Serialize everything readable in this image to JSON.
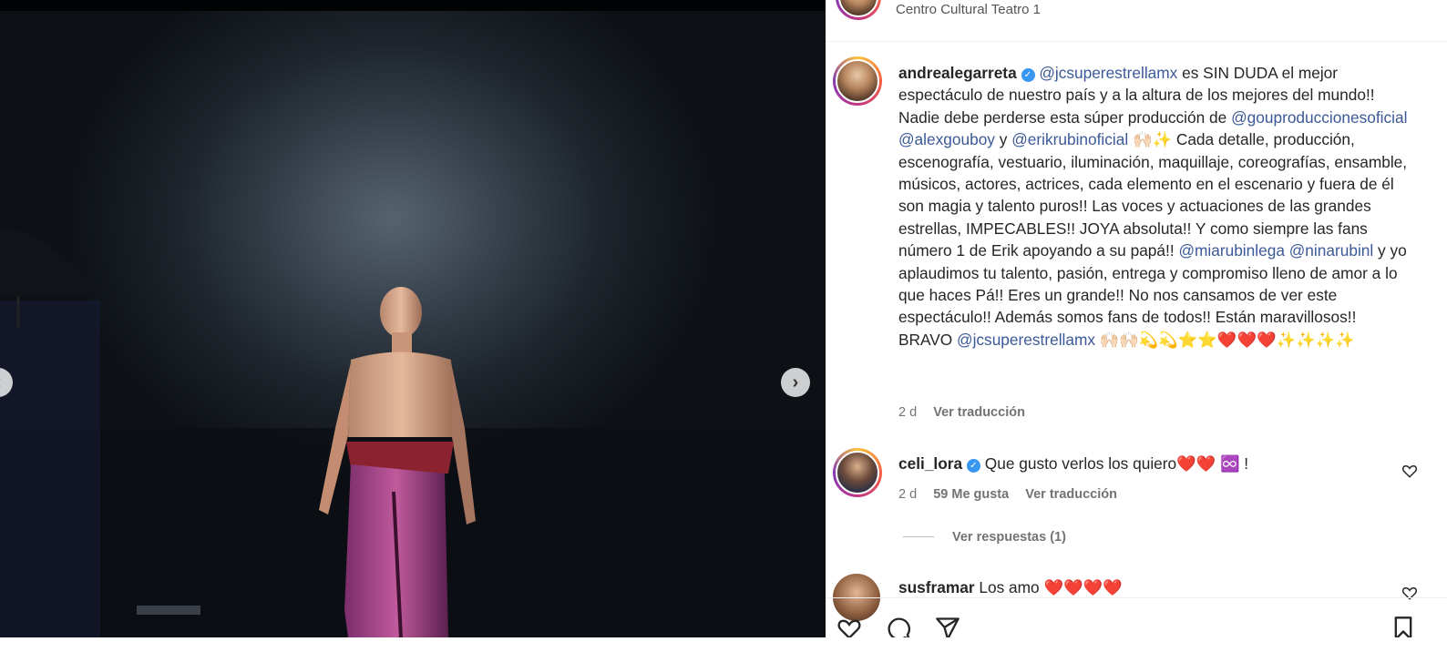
{
  "post": {
    "location": "Centro Cultural Teatro 1",
    "media_alt": "Performer on stage",
    "caption": {
      "username": "andrealegarreta",
      "verified": true,
      "segments": [
        {
          "type": "mention",
          "text": "@jcsuperestrellamx"
        },
        {
          "type": "text",
          "text": " es SIN DUDA el mejor espectáculo de nuestro país y a la altura de los mejores del mundo!! Nadie debe perderse esta súper producción de "
        },
        {
          "type": "mention",
          "text": "@gouproduccionesoficial"
        },
        {
          "type": "text",
          "text": " "
        },
        {
          "type": "mention",
          "text": "@alexgouboy"
        },
        {
          "type": "text",
          "text": " y "
        },
        {
          "type": "mention",
          "text": "@erikrubinoficial"
        },
        {
          "type": "text",
          "text": " 🙌🏻✨ Cada detalle, producción, escenografía, vestuario, iluminación, maquillaje, coreografías, ensamble, músicos, actores, actrices, cada elemento en el escenario y fuera de él son magia y talento puros!! Las voces y actuaciones de las grandes estrellas, IMPECABLES!! JOYA absoluta!! Y como siempre las fans número 1 de Erik apoyando a su papá!! "
        },
        {
          "type": "mention",
          "text": "@miarubinlega"
        },
        {
          "type": "text",
          "text": " "
        },
        {
          "type": "mention",
          "text": "@ninarubinl"
        },
        {
          "type": "text",
          "text": " y yo aplaudimos tu talento, pasión, entrega y compromiso lleno de amor a lo que haces Pá!! Eres un grande!! No nos cansamos de ver este espectáculo!! Además somos fans de todos!! Están maravillosos!! BRAVO "
        },
        {
          "type": "mention",
          "text": "@jcsuperestrellamx"
        },
        {
          "type": "text",
          "text": " 🙌🏻🙌🏻💫💫⭐⭐❤️❤️❤️✨✨✨✨"
        }
      ],
      "time": "2 d",
      "translate_label": "Ver traducción"
    },
    "comments": [
      {
        "username": "celi_lora",
        "verified": true,
        "text": "Que gusto verlos los quiero❤️❤️ ♾️ !",
        "time": "2 d",
        "likes": "59 Me gusta",
        "translate_label": "Ver traducción",
        "replies_label": "Ver respuestas (1)"
      },
      {
        "username": "susframar",
        "verified": false,
        "text": "Los amo ❤️❤️❤️❤️"
      }
    ]
  },
  "colors": {
    "mention": "#3b5998",
    "verified": "#3897f0",
    "muted": "#737373"
  },
  "icons": {
    "next": "chevron-right-icon",
    "prev": "chevron-left-icon",
    "like": "heart-icon",
    "comment": "comment-icon",
    "share": "send-icon",
    "save": "bookmark-icon"
  }
}
